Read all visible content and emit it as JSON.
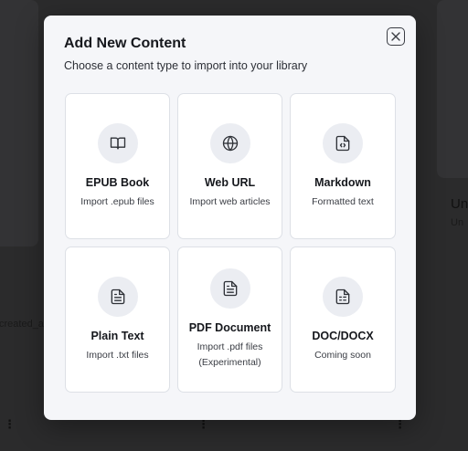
{
  "modal": {
    "title": "Add New Content",
    "subtitle": "Choose a content type to import into your library",
    "close_icon": "close-x-icon",
    "options": [
      {
        "title": "EPUB Book",
        "description": "Import .epub files",
        "icon": "book-open-icon"
      },
      {
        "title": "Web URL",
        "description": "Import web articles",
        "icon": "globe-icon"
      },
      {
        "title": "Markdown",
        "description": "Formatted text",
        "icon": "file-code-icon"
      },
      {
        "title": "Plain Text",
        "description": "Import .txt files",
        "icon": "file-text-icon"
      },
      {
        "title": "PDF Document",
        "description": "Import .pdf files",
        "note": "(Experimental)",
        "icon": "file-text-icon"
      },
      {
        "title": "DOC/DOCX",
        "description": "Coming soon",
        "icon": "file-spreadsheet-icon"
      }
    ]
  },
  "background": {
    "right_title": "Un",
    "right_subtitle": "Un",
    "left_text": "created_a",
    "menu_glyph": "⋮"
  }
}
